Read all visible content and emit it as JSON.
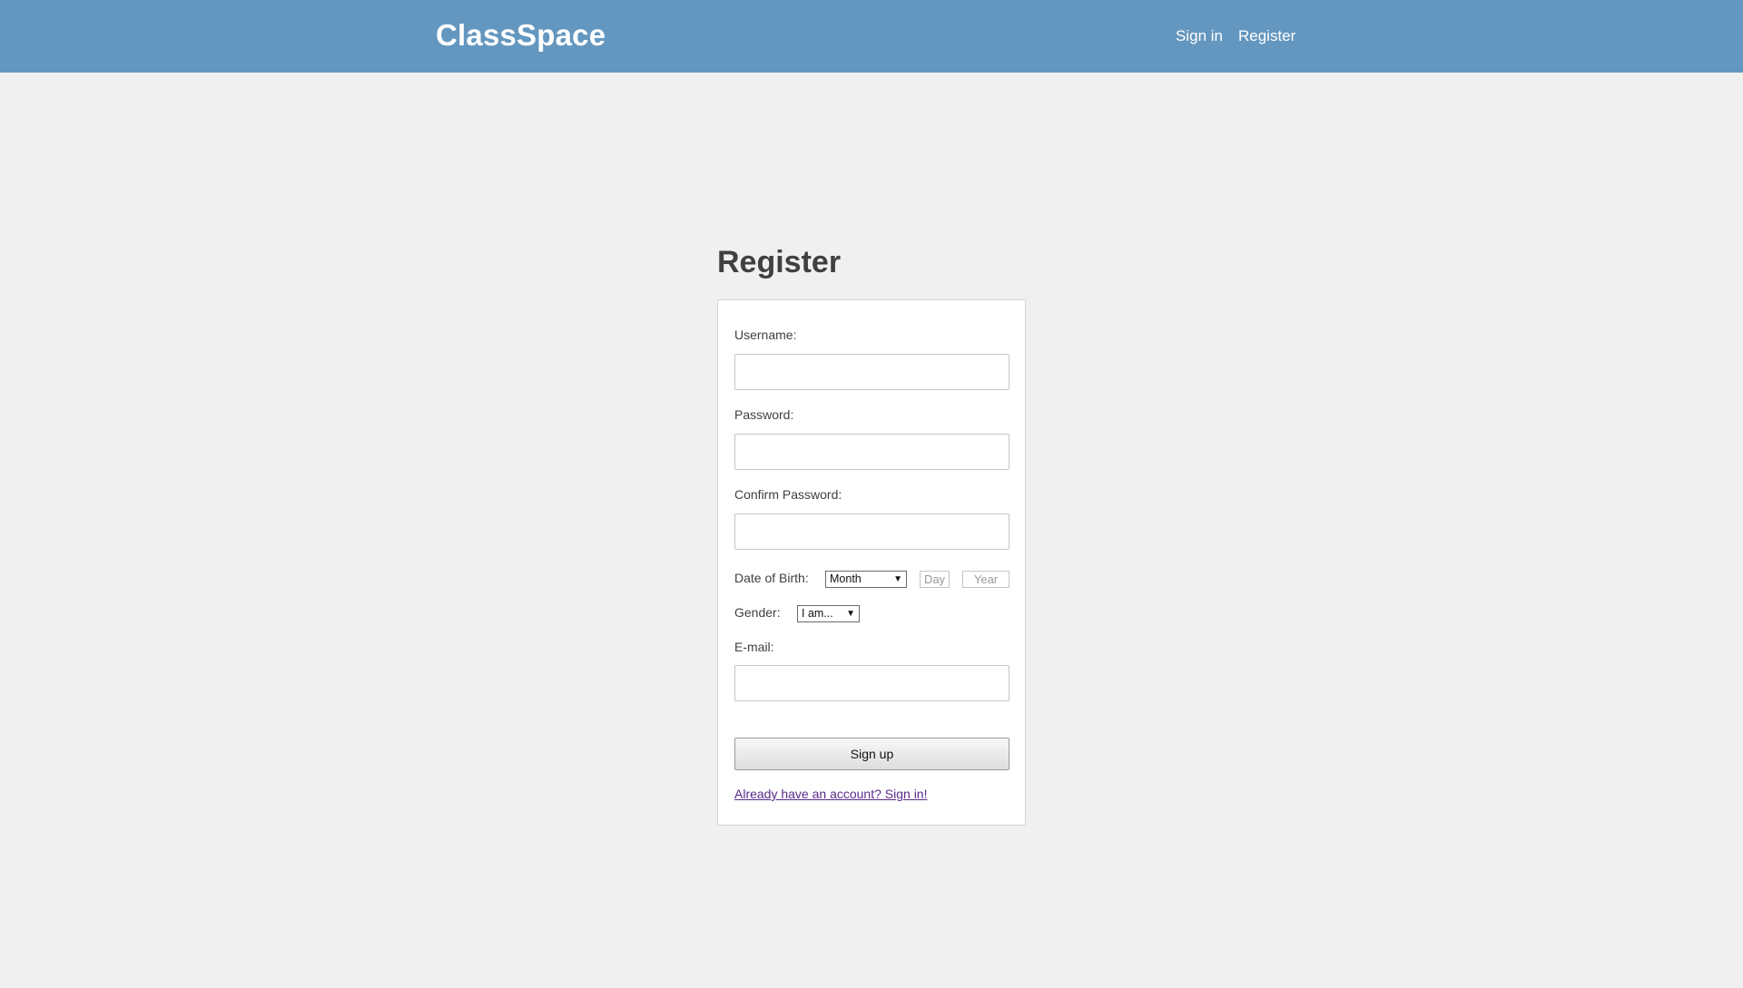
{
  "header": {
    "brand": "ClassSpace",
    "nav": {
      "sign_in": "Sign in",
      "register": "Register"
    },
    "background_color": "#6497bf"
  },
  "page": {
    "title": "Register"
  },
  "form": {
    "username_label": "Username:",
    "username_value": "",
    "password_label": "Password:",
    "password_value": "",
    "confirm_password_label": "Confirm Password:",
    "confirm_password_value": "",
    "dob_label": "Date of Birth:",
    "dob_month_selected": "Month",
    "dob_day_placeholder": "Day",
    "dob_year_placeholder": "Year",
    "gender_label": "Gender:",
    "gender_selected": "I am...",
    "email_label": "E-mail:",
    "email_value": "",
    "submit_label": "Sign up",
    "signin_link": "Already have an account? Sign in!"
  },
  "colors": {
    "page_background": "#f0f0f0",
    "link_visited": "#5a2a8a",
    "title_text": "#404040"
  },
  "icons": {
    "dropdown_arrow": "chevron-down-icon"
  }
}
